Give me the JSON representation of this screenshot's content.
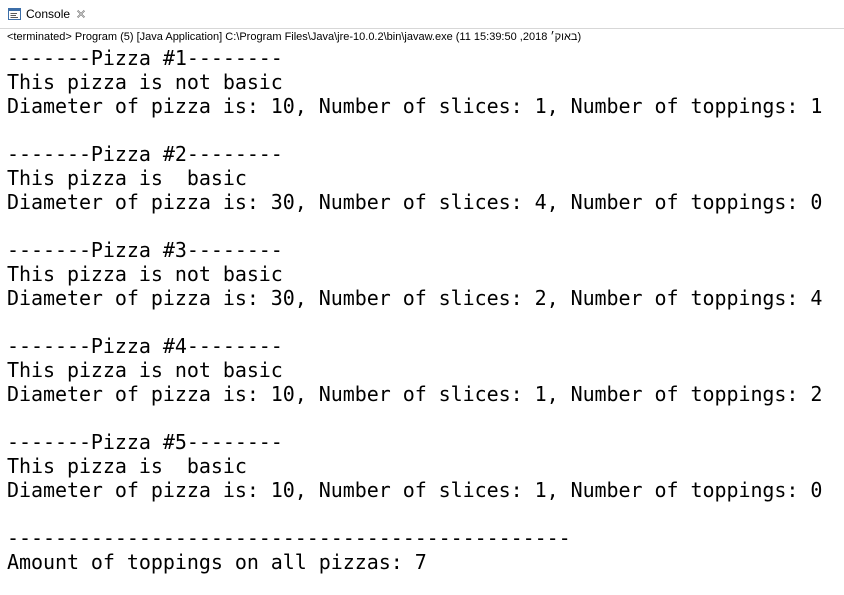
{
  "tab": {
    "label": "Console",
    "icon": "console-icon",
    "close_icon": "close-icon"
  },
  "status": {
    "text": "<terminated> Program (5) [Java Application] C:\\Program Files\\Java\\jre-10.0.2\\bin\\javaw.exe (11 15:39:50 ,2018 באוק׳)"
  },
  "output": {
    "lines": [
      "-------Pizza #1--------",
      "This pizza is not basic",
      "Diameter of pizza is: 10, Number of slices: 1, Number of toppings: 1",
      "",
      "-------Pizza #2--------",
      "This pizza is  basic",
      "Diameter of pizza is: 30, Number of slices: 4, Number of toppings: 0",
      "",
      "-------Pizza #3--------",
      "This pizza is not basic",
      "Diameter of pizza is: 30, Number of slices: 2, Number of toppings: 4",
      "",
      "-------Pizza #4--------",
      "This pizza is not basic",
      "Diameter of pizza is: 10, Number of slices: 1, Number of toppings: 2",
      "",
      "-------Pizza #5--------",
      "This pizza is  basic",
      "Diameter of pizza is: 10, Number of slices: 1, Number of toppings: 0",
      "",
      "-----------------------------------------------",
      "Amount of toppings on all pizzas: 7"
    ]
  },
  "colors": {
    "background": "#ffffff",
    "text": "#000000",
    "icon_blue": "#3c6ea8",
    "divider": "#d7d7d7"
  }
}
